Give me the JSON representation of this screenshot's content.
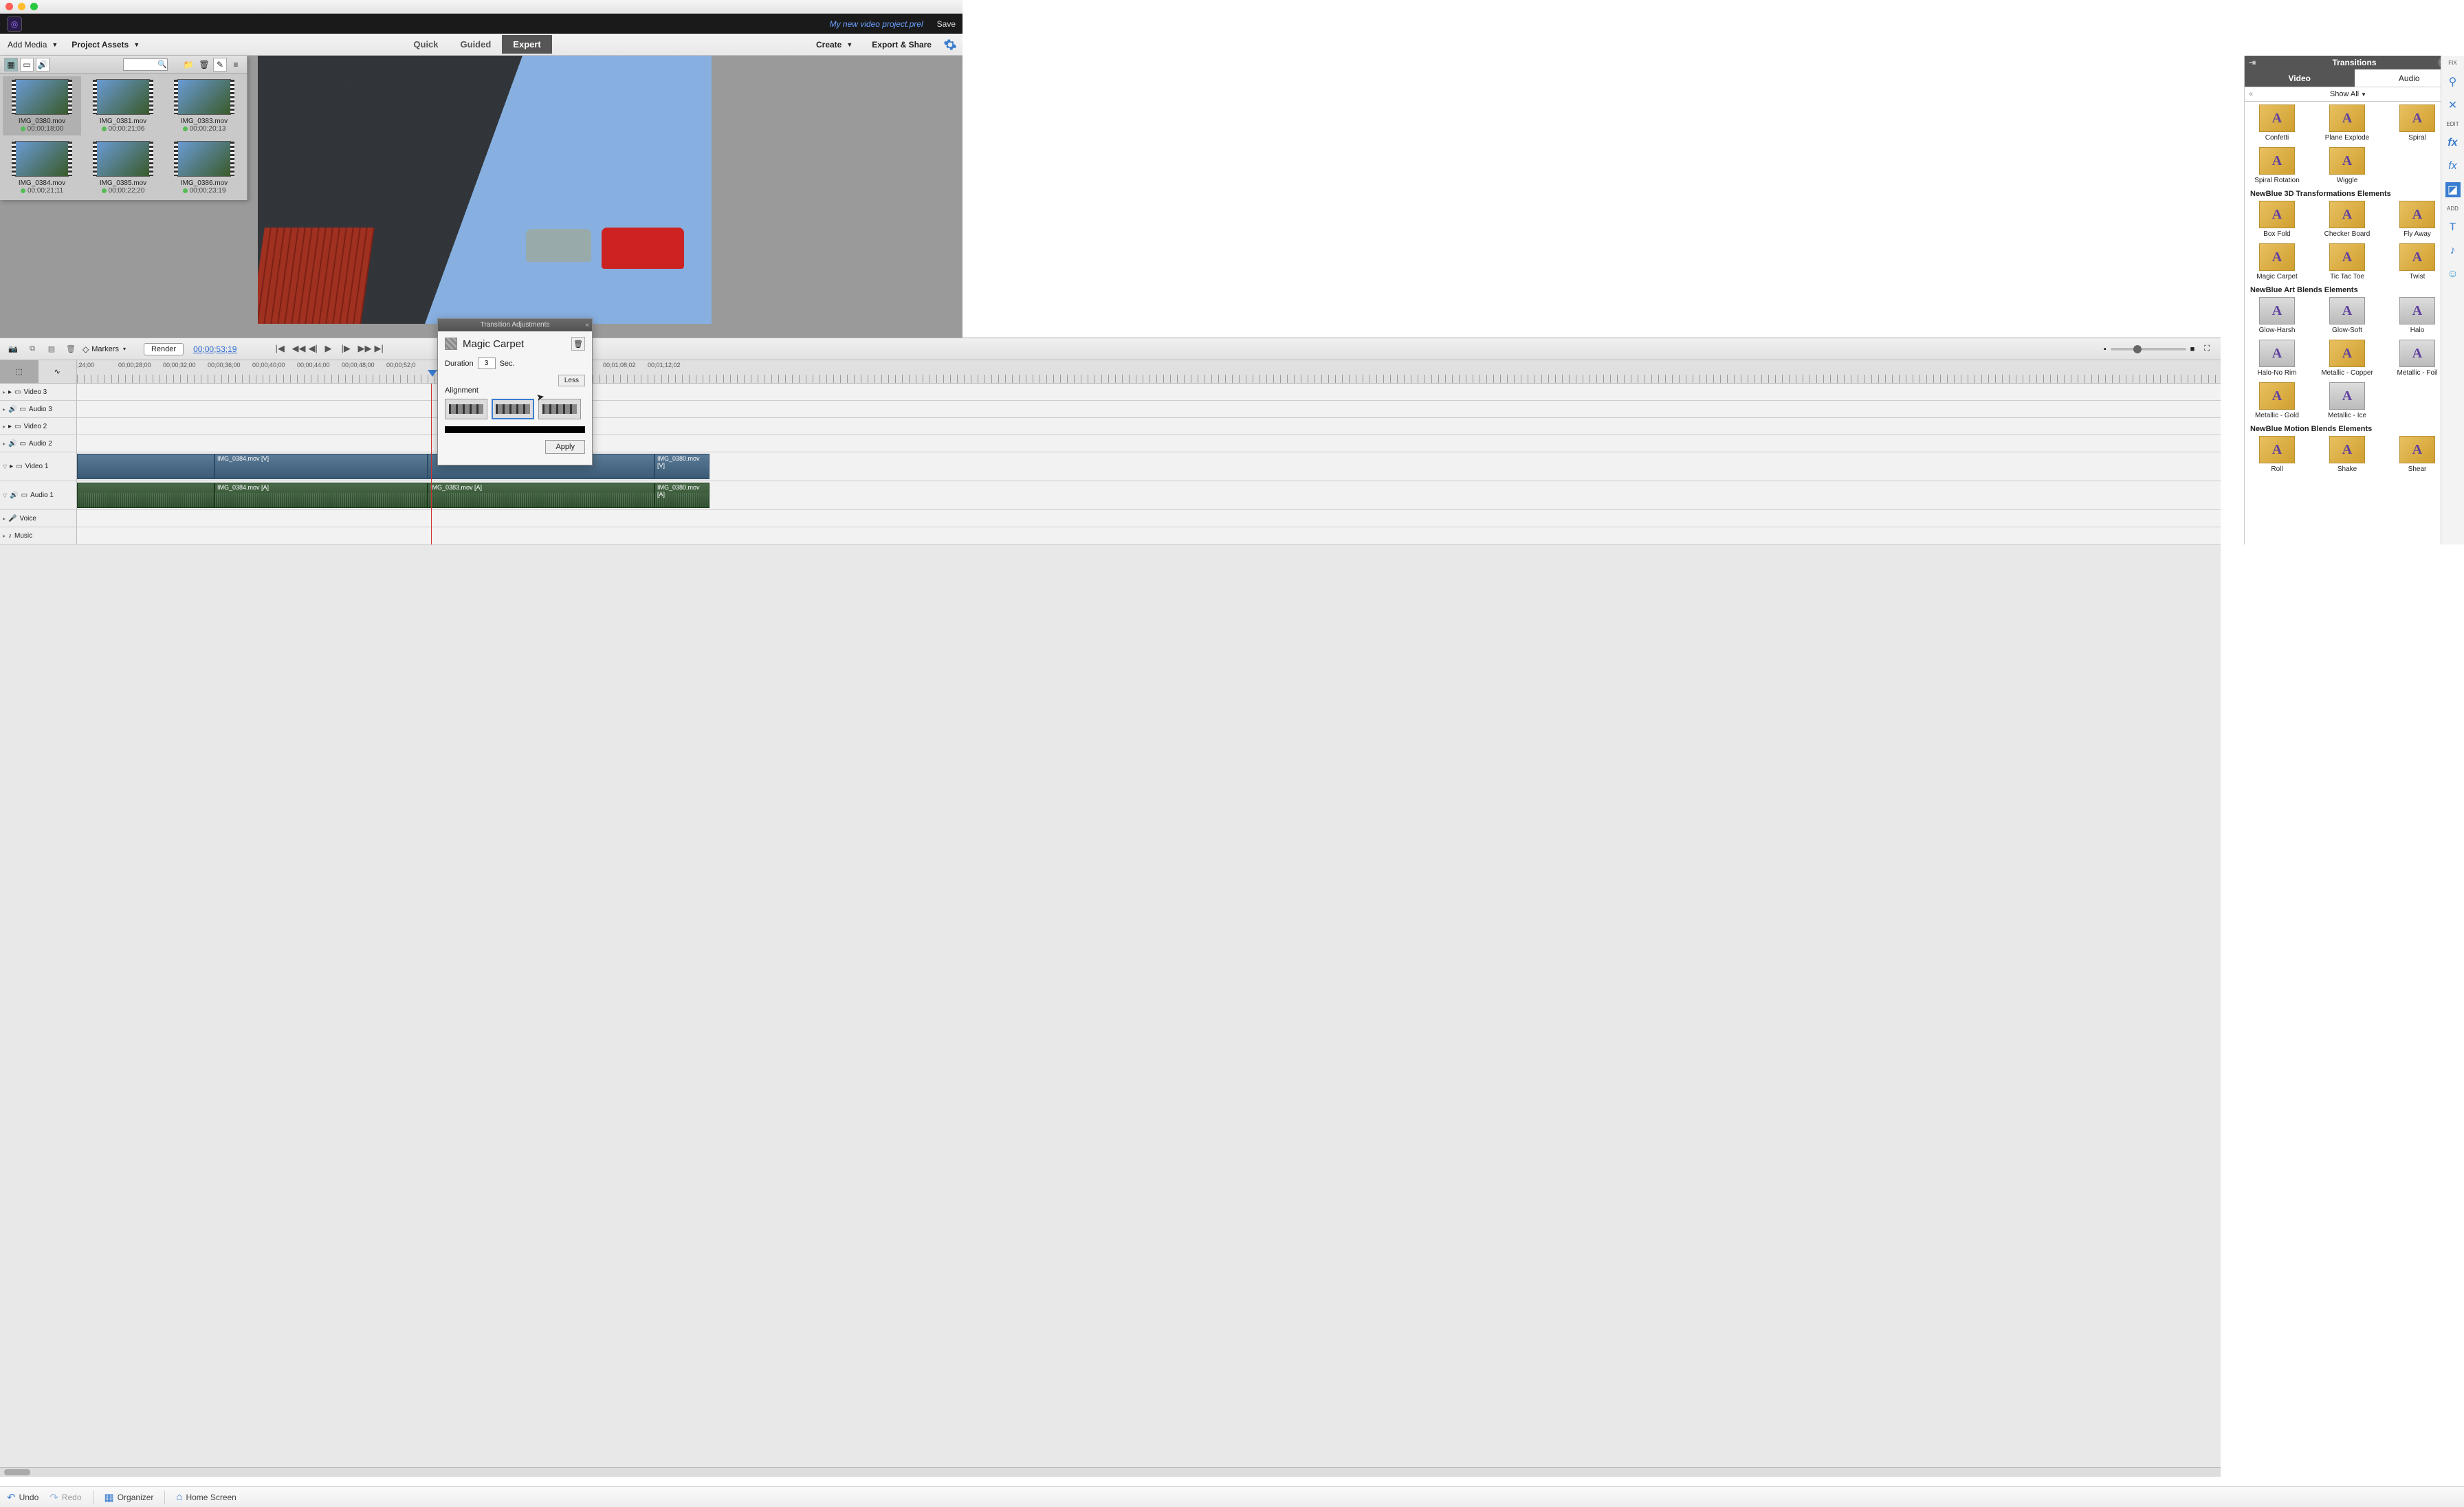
{
  "window": {
    "project_name": "My new video project.prel",
    "save": "Save"
  },
  "toolbar": {
    "add_media": "Add Media",
    "project_assets": "Project Assets",
    "modes": {
      "quick": "Quick",
      "guided": "Guided",
      "expert": "Expert"
    },
    "create": "Create",
    "export": "Export & Share"
  },
  "assets": {
    "clips": [
      {
        "name": "IMG_0380.mov",
        "tc": "00;00;18;00",
        "selected": true
      },
      {
        "name": "IMG_0381.mov",
        "tc": "00;00;21;06"
      },
      {
        "name": "IMG_0383.mov",
        "tc": "00;00;20;13"
      },
      {
        "name": "IMG_0384.mov",
        "tc": "00;00;21;11"
      },
      {
        "name": "IMG_0385.mov",
        "tc": "00;00;22;20"
      },
      {
        "name": "IMG_0386.mov",
        "tc": "00;00;23;19"
      }
    ]
  },
  "transitions": {
    "title": "Transitions",
    "tabs": {
      "video": "Video",
      "audio": "Audio"
    },
    "filter": "Show All",
    "groups": [
      {
        "cat": "",
        "items": [
          "Confetti",
          "Plane Explode",
          "Spiral"
        ]
      },
      {
        "cat": "",
        "items": [
          "Spiral Rotation",
          "Wiggle"
        ]
      },
      {
        "cat": "NewBlue 3D Transformations Elements",
        "items": [
          "Box Fold",
          "Checker Board",
          "Fly Away"
        ]
      },
      {
        "cat": "",
        "items": [
          "Magic Carpet",
          "Tic Tac Toe",
          "Twist"
        ]
      },
      {
        "cat": "NewBlue Art Blends Elements",
        "items": [
          "Glow-Harsh",
          "Glow-Soft",
          "Halo"
        ]
      },
      {
        "cat": "",
        "items": [
          "Halo-No Rim",
          "Metallic - Copper",
          "Metallic - Foil"
        ]
      },
      {
        "cat": "",
        "items": [
          "Metallic - Gold",
          "Metallic - Ice"
        ]
      },
      {
        "cat": "NewBlue Motion Blends Elements",
        "items": [
          "Roll",
          "Shake",
          "Shear"
        ]
      }
    ]
  },
  "rstrip": {
    "fix": "FIX",
    "edit": "EDIT",
    "add": "ADD"
  },
  "timeline": {
    "markers": "Markers",
    "render": "Render",
    "current_tc": "00;00;53;19",
    "ruler": [
      ";24;00",
      "00;00;28;00",
      "00;00;32;00",
      "00;00;36;00",
      "00;00;40;00",
      "00;00;44;00",
      "00;00;48;00",
      "00;00;52;0",
      "00;01;08;02",
      "00;01;12;02"
    ],
    "tracks": {
      "v3": "Video 3",
      "a3": "Audio 3",
      "v2": "Video 2",
      "a2": "Audio 2",
      "v1": "Video 1",
      "a1": "Audio 1",
      "voice": "Voice",
      "music": "Music"
    },
    "clips": {
      "v1a": "IMG_0384.mov [V]",
      "v1b": "IMG_0380.mov [V]",
      "a1a": "IMG_0384.mov [A]",
      "a1b": "IMG_0383.mov [A]",
      "a1c": "IMG_0380.mov [A]"
    }
  },
  "dialog": {
    "title": "Transition Adjustments",
    "name": "Magic Carpet",
    "duration_label": "Duration",
    "duration_value": "3",
    "duration_unit": "Sec.",
    "less": "Less",
    "alignment": "Alignment",
    "apply": "Apply"
  },
  "bottom": {
    "undo": "Undo",
    "redo": "Redo",
    "organizer": "Organizer",
    "home": "Home Screen"
  }
}
